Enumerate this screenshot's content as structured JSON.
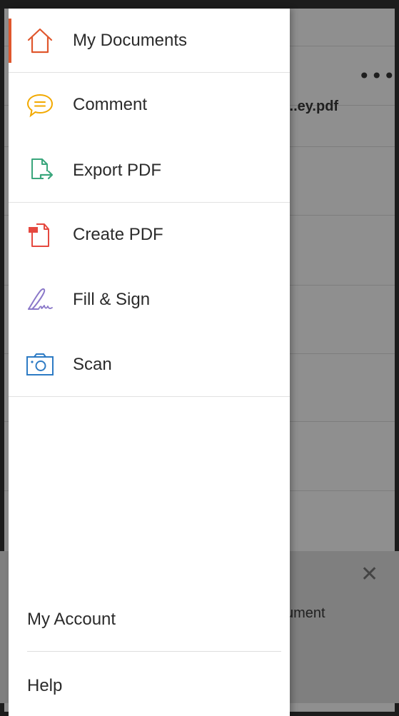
{
  "background": {
    "file_name_fragment": "...ey.pdf",
    "more_glyph": "•••",
    "banner_close_glyph": "✕",
    "banner_text_fragment": "ument"
  },
  "drawer": {
    "active_color": "#e0572d",
    "items": [
      {
        "label": "My Documents",
        "icon": "home-icon",
        "color": "#e0572d",
        "active": true
      },
      {
        "label": "Comment",
        "icon": "comment-icon",
        "color": "#f2a900"
      },
      {
        "label": "Export PDF",
        "icon": "export-pdf-icon",
        "color": "#3aa67c"
      },
      {
        "label": "Create PDF",
        "icon": "create-pdf-icon",
        "color": "#e5483f"
      },
      {
        "label": "Fill & Sign",
        "icon": "fill-sign-icon",
        "color": "#8a78c9"
      },
      {
        "label": "Scan",
        "icon": "camera-icon",
        "color": "#2d7bc4"
      }
    ],
    "bottom": {
      "account_label": "My Account",
      "help_label": "Help"
    }
  }
}
